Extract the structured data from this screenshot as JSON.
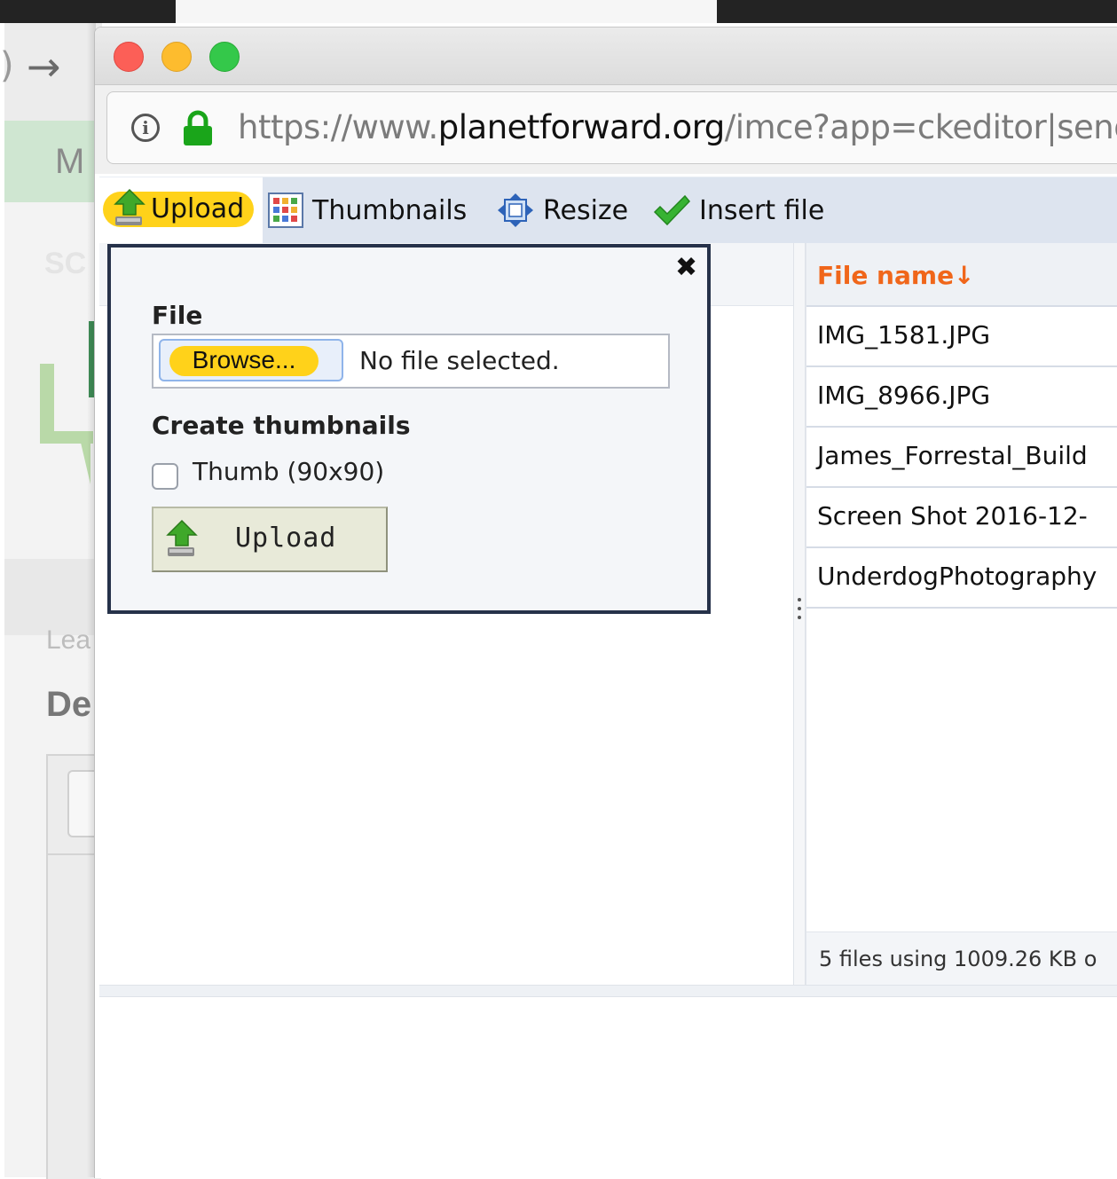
{
  "background": {
    "partial_heading": "M",
    "partial_faded": "SC",
    "partial_lea": "Lea",
    "partial_de": "De"
  },
  "browser": {
    "url_prefix": "https://www.",
    "url_domain": "planetforward.org",
    "url_suffix": "/imce?app=ckeditor|sendto"
  },
  "toolbar": {
    "upload": "Upload",
    "thumbnails": "Thumbnails",
    "resize": "Resize",
    "insert": "Insert file"
  },
  "dialog": {
    "file_label": "File",
    "browse": "Browse...",
    "no_file": "No file selected.",
    "thumbs_heading": "Create thumbnails",
    "thumb_option": "Thumb (90x90)",
    "upload_button": "Upload",
    "close_glyph": "✖"
  },
  "file_list": {
    "header": "File name↓",
    "rows": [
      "IMG_1581.JPG",
      "IMG_8966.JPG",
      "James_Forrestal_Build",
      "Screen Shot 2016-12-",
      "UnderdogPhotography"
    ],
    "footer": "5 files using 1009.26 KB o"
  },
  "colors": {
    "highlight_yellow": "#ffd21a",
    "header_orange": "#f0661a",
    "dialog_border": "#26324a",
    "toolbar_bg": "#dde4ef"
  }
}
